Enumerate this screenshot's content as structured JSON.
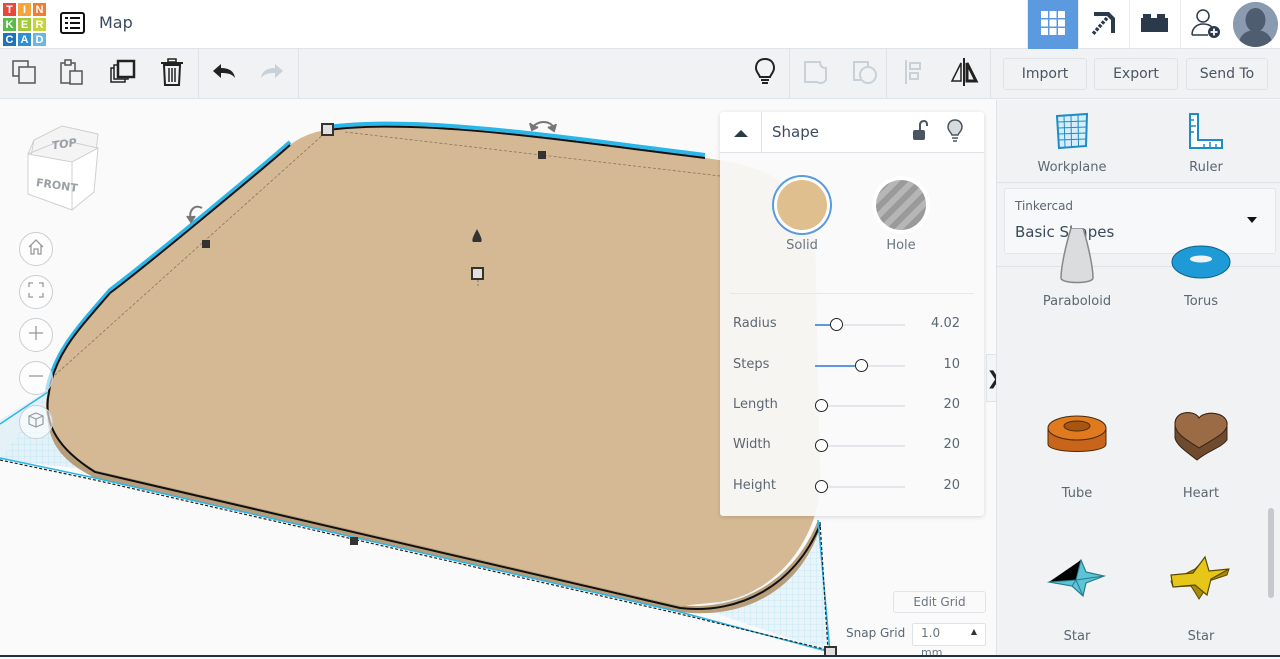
{
  "app": {
    "logo_letters": [
      "T",
      "I",
      "N",
      "K",
      "E",
      "R",
      "C",
      "A",
      "D"
    ],
    "logo_colors": [
      "#e8473a",
      "#f5a33b",
      "#f17d32",
      "#5cb94a",
      "#a2c93a",
      "#c8d23d",
      "#1d74bb",
      "#2f8fd4",
      "#6cb6e0"
    ],
    "title": "Map"
  },
  "top_right": {
    "buttons": [
      {
        "name": "3d-design-view",
        "icon": "grid-icon",
        "active": true
      },
      {
        "name": "minecraft-view",
        "icon": "pickaxe-icon",
        "active": false
      },
      {
        "name": "brick-view",
        "icon": "brick-icon",
        "active": false
      },
      {
        "name": "invite-user",
        "icon": "add-user-icon",
        "active": false
      }
    ],
    "avatar": "user-avatar"
  },
  "toolbar": {
    "left_tools": [
      "copy",
      "paste",
      "duplicate",
      "delete",
      "undo",
      "redo"
    ],
    "right_tools": [
      "notes-bulb",
      "group",
      "ungroup",
      "align",
      "mirror"
    ],
    "import_label": "Import",
    "export_label": "Export",
    "send_to_label": "Send To"
  },
  "viewport": {
    "view_cube": {
      "top": "TOP",
      "front": "FRONT"
    },
    "controls": [
      "home-view",
      "fit-view",
      "zoom-in",
      "zoom-out",
      "perspective-toggle"
    ],
    "edit_grid_label": "Edit Grid",
    "snap_grid_label": "Snap Grid",
    "snap_grid_value": "1.0",
    "snap_grid_unit": "mm",
    "shape_color": "#d5b994"
  },
  "shape_panel": {
    "title": "Shape",
    "solid_label": "Solid",
    "hole_label": "Hole",
    "solid_color": "#e0bf8e",
    "selected_type": "Solid",
    "properties": [
      {
        "label": "Radius",
        "value": "4.02",
        "fraction": 0.17
      },
      {
        "label": "Steps",
        "value": "10",
        "fraction": 0.44
      },
      {
        "label": "Length",
        "value": "20",
        "fraction": 0.0
      },
      {
        "label": "Width",
        "value": "20",
        "fraction": 0.0
      },
      {
        "label": "Height",
        "value": "20",
        "fraction": 0.0
      }
    ]
  },
  "right_panel": {
    "workplane_label": "Workplane",
    "ruler_label": "Ruler",
    "library_category": "Tinkercad",
    "library_name": "Basic Shapes",
    "shapes": [
      {
        "label": "Paraboloid",
        "color": "#d8dadc"
      },
      {
        "label": "Torus",
        "color": "#1e9bd7"
      },
      {
        "label": "Tube",
        "color": "#e07a1f"
      },
      {
        "label": "Heart",
        "color": "#9a6b45"
      },
      {
        "label": "Star",
        "color": "#5bc4d6"
      },
      {
        "label": "Star",
        "color": "#e6c619"
      }
    ]
  },
  "accent_color": "#5b9ade"
}
